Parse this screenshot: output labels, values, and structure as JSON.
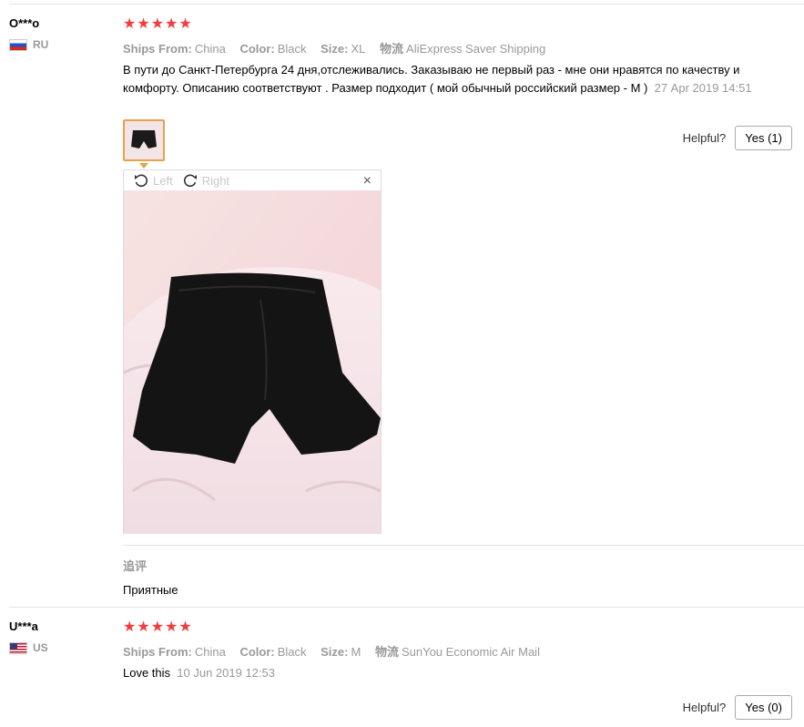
{
  "reviews": [
    {
      "user": "O***o",
      "country": "RU",
      "rating": "★★★★★",
      "ships_from_label": "Ships From:",
      "ships_from": "China",
      "color_label": "Color:",
      "color": "Black",
      "size_label": "Size:",
      "size": "XL",
      "logistics_label": "物流",
      "logistics": "AliExpress Saver Shipping",
      "text": "В пути до Санкт-Петербурга 24 дня,отслеживались. Заказываю не первый раз - мне они нравятся по качеству и комфорту. Описанию соответствуют . Размер подходит ( мой обычный российский размер - М )",
      "date": "27 Apr 2019 14:51",
      "helpful_label": "Helpful?",
      "yes_label": "Yes (1)",
      "followup_title": "追评",
      "followup_text": "Приятные"
    },
    {
      "user": "U***a",
      "country": "US",
      "rating": "★★★★★",
      "ships_from_label": "Ships From:",
      "ships_from": "China",
      "color_label": "Color:",
      "color": "Black",
      "size_label": "Size:",
      "size": "M",
      "logistics_label": "物流",
      "logistics": "SunYou Economic Air Mail",
      "text": "Love this",
      "date": "10 Jun 2019 12:53",
      "helpful_label": "Helpful?",
      "yes_label": "Yes (0)"
    }
  ],
  "viewer": {
    "rotate_left": "Left",
    "rotate_right": "Right",
    "close": "×"
  }
}
